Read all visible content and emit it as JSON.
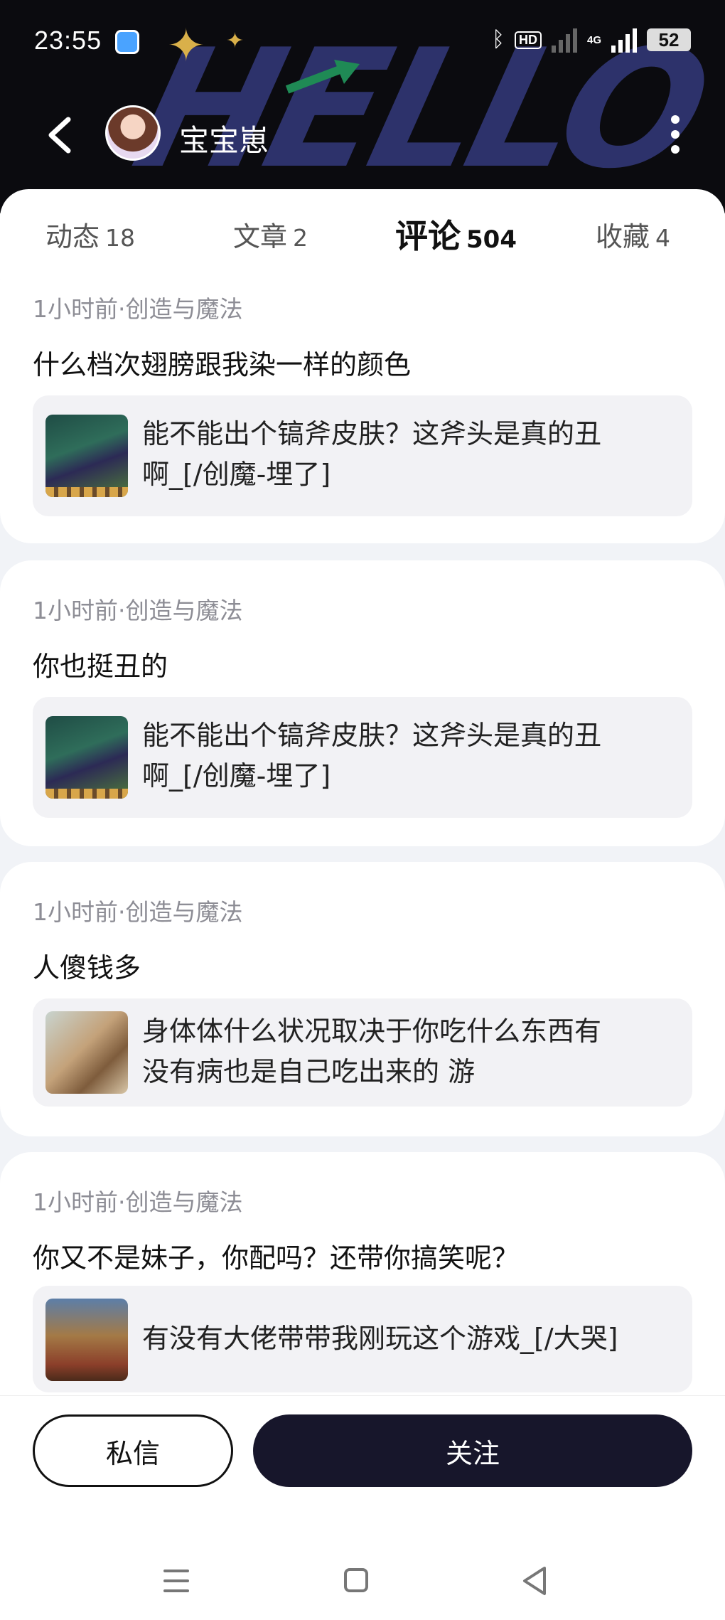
{
  "status_bar": {
    "time": "23:55",
    "hd_label": "HD",
    "network_label": "4G",
    "battery": "52"
  },
  "header": {
    "banner_text": "HELLO",
    "user_name": "宝宝崽"
  },
  "tabs": [
    {
      "label": "动态",
      "count": "18"
    },
    {
      "label": "文章",
      "count": "2"
    },
    {
      "label": "评论",
      "count": "504",
      "active": true
    },
    {
      "label": "收藏",
      "count": "4"
    }
  ],
  "comments": [
    {
      "meta": "1小时前·创造与魔法",
      "text": "什么档次翅膀跟我染一样的颜色",
      "quote_line1": "能不能出个镐斧皮肤？这斧头是真的丑",
      "quote_line2": "啊_[/创魔-埋了]",
      "thumb": "game-screenshot"
    },
    {
      "meta": "1小时前·创造与魔法",
      "text": "你也挺丑的",
      "quote_line1": "能不能出个镐斧皮肤？这斧头是真的丑",
      "quote_line2": "啊_[/创魔-埋了]",
      "thumb": "game-screenshot"
    },
    {
      "meta": "1小时前·创造与魔法",
      "text": "人傻钱多",
      "quote_line1": "身体体什么状况取决于你吃什么东西有",
      "quote_line2": "没有病也是自己吃出来的 游",
      "thumb": "lion-image"
    },
    {
      "meta": "1小时前·创造与魔法",
      "text": "你又不是妹子，你配吗？还带你搞笑呢？",
      "quote_line1": "有没有大佬带带我刚玩这个游戏_[/大哭]",
      "quote_line2": "",
      "thumb": "tower-image"
    }
  ],
  "actions": {
    "dm_label": "私信",
    "follow_label": "关注"
  },
  "icons": {
    "back": "back-arrow-icon",
    "more": "more-vertical-icon",
    "nav_menu": "menu-icon",
    "nav_home": "home-icon",
    "nav_back": "back-triangle-icon"
  },
  "colors": {
    "accent_underline": "#b7b0ef",
    "follow_button": "#17162b",
    "header_bg": "#0b0b0f"
  }
}
